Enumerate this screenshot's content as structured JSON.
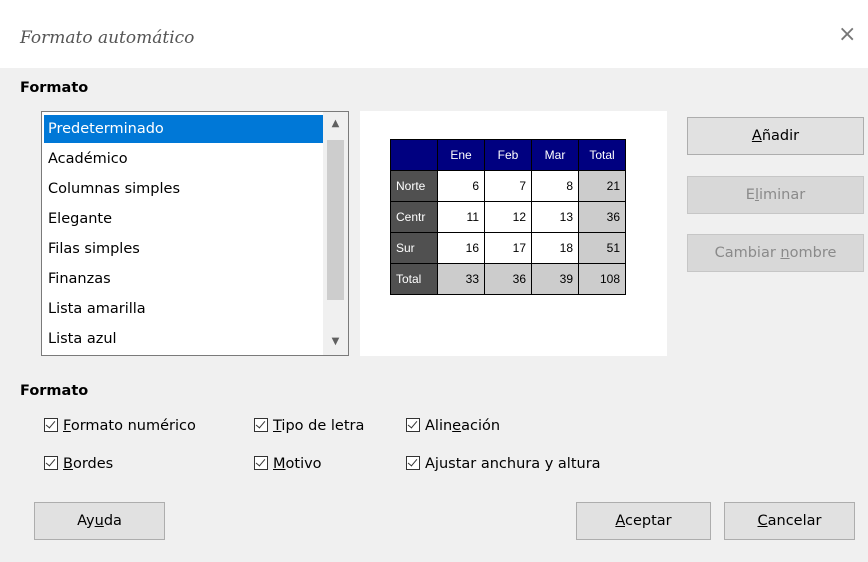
{
  "dialog": {
    "title": "Formato automático",
    "close_glyph": "×"
  },
  "format_section": {
    "label": "Formato"
  },
  "format_list": {
    "items": [
      "Predeterminado",
      "Académico",
      "Columnas simples",
      "Elegante",
      "Filas simples",
      "Finanzas",
      "Lista amarilla",
      "Lista azul"
    ],
    "selected_index": 0
  },
  "preview": {
    "header": [
      "",
      "Ene",
      "Feb",
      "Mar",
      "Total"
    ],
    "rows": [
      [
        "Norte",
        "6",
        "7",
        "8",
        "21"
      ],
      [
        "Centr",
        "11",
        "12",
        "13",
        "36"
      ],
      [
        "Sur",
        "16",
        "17",
        "18",
        "51"
      ],
      [
        "Total",
        "33",
        "36",
        "39",
        "108"
      ]
    ],
    "colors": {
      "header_bg": "#000080",
      "rowheader_bg": "#505050",
      "total_bg": "#cccccc"
    }
  },
  "buttons": {
    "add": {
      "pre": "",
      "key": "A",
      "post": "ñadir"
    },
    "delete": {
      "pre": "E",
      "key": "l",
      "post": "iminar"
    },
    "rename": {
      "pre": "Cambiar ",
      "key": "n",
      "post": "ombre"
    },
    "help": {
      "pre": "Ay",
      "key": "u",
      "post": "da"
    },
    "ok": {
      "pre": "",
      "key": "A",
      "post": "ceptar"
    },
    "cancel": {
      "pre": "",
      "key": "C",
      "post": "ancelar"
    }
  },
  "options_section": {
    "label": "Formato"
  },
  "options": {
    "number_format": {
      "pre": "",
      "key": "F",
      "post": "ormato numérico",
      "checked": true
    },
    "borders": {
      "pre": "",
      "key": "B",
      "post": "ordes",
      "checked": true
    },
    "font": {
      "pre": "",
      "key": "T",
      "post": "ipo de letra",
      "checked": true
    },
    "pattern": {
      "pre": "",
      "key": "M",
      "post": "otivo",
      "checked": true
    },
    "alignment": {
      "pre": "Alin",
      "key": "e",
      "post": "ación",
      "checked": true
    },
    "autofit": {
      "pre": "A",
      "key": "j",
      "post": "ustar anchura y altura",
      "checked": true
    }
  }
}
